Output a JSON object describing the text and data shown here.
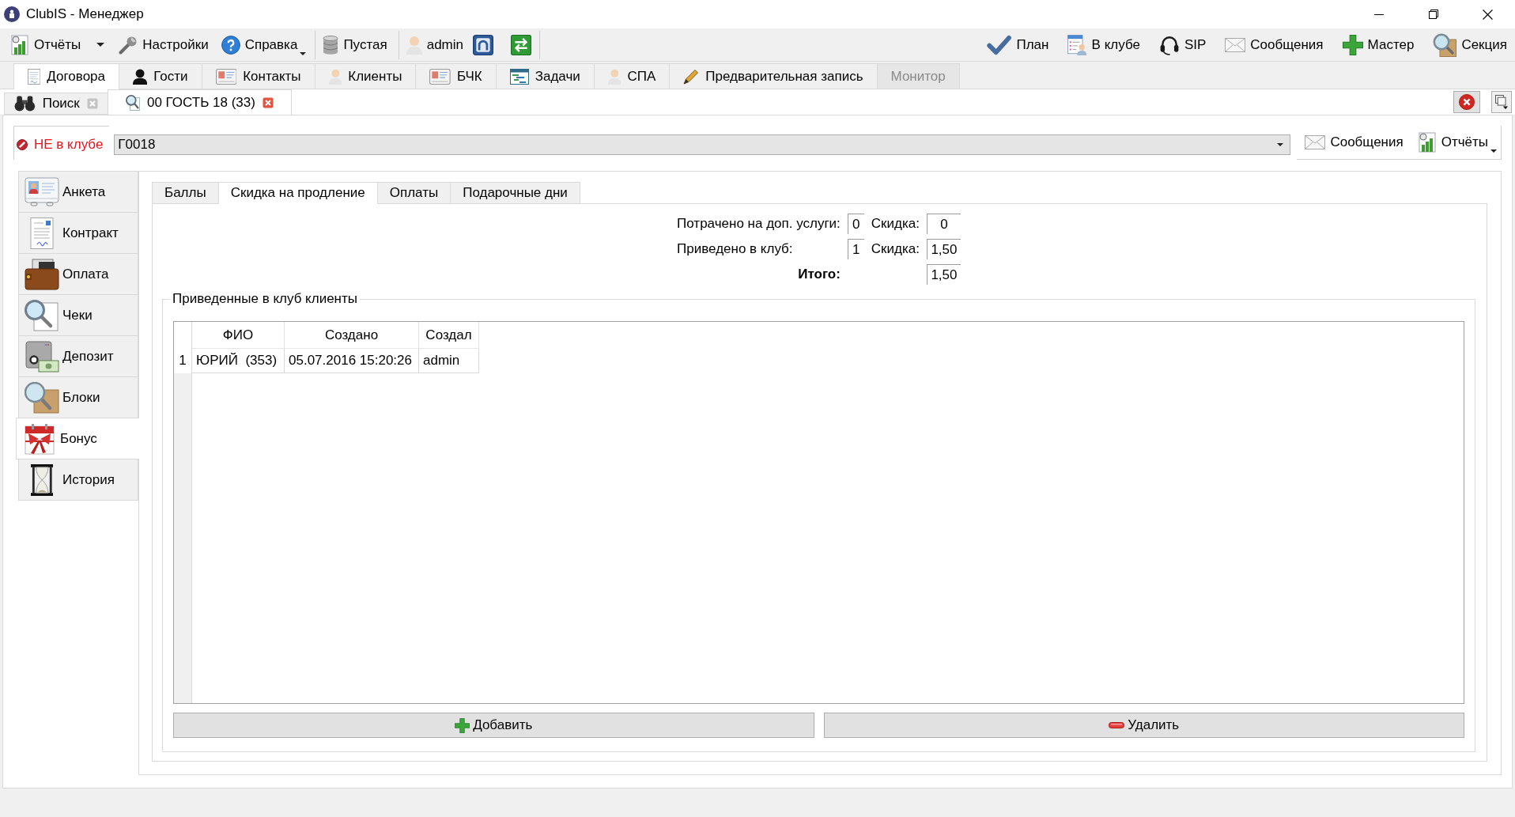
{
  "window": {
    "title": "ClubIS - Менеджер"
  },
  "toolbar": {
    "groups": [
      [
        {
          "label": "Отчёты",
          "kind": "split"
        },
        {
          "label": "Настройки",
          "kind": "plain"
        },
        {
          "label": "Справка",
          "kind": "menu"
        }
      ],
      [
        {
          "label": "Пустая",
          "kind": "plain"
        }
      ],
      [
        {
          "label": "admin",
          "kind": "plain"
        }
      ]
    ],
    "right": [
      {
        "label": "План"
      },
      {
        "label": "В клубе"
      },
      {
        "label": "SIP"
      },
      {
        "label": "Сообщения"
      },
      {
        "label": "Мастер"
      },
      {
        "label": "Секция"
      }
    ]
  },
  "main_tabs": [
    {
      "label": "Договора",
      "selected": true,
      "disabled": false
    },
    {
      "label": "Гости",
      "selected": false,
      "disabled": false
    },
    {
      "label": "Контакты",
      "selected": false,
      "disabled": false
    },
    {
      "label": "Клиенты",
      "selected": false,
      "disabled": false
    },
    {
      "label": "БЧК",
      "selected": false,
      "disabled": false
    },
    {
      "label": "Задачи",
      "selected": false,
      "disabled": false
    },
    {
      "label": "СПА",
      "selected": false,
      "disabled": false
    },
    {
      "label": "Предварительная запись",
      "selected": false,
      "disabled": false
    },
    {
      "label": "Монитор",
      "selected": false,
      "disabled": true
    }
  ],
  "document_tabs": [
    {
      "label": "Поиск",
      "selected": false
    },
    {
      "label": "00 ГОСТЬ 18 (33)",
      "selected": true
    }
  ],
  "client_bar": {
    "status": {
      "label": "НЕ в клубе",
      "in_club": false
    },
    "card": {
      "value": "Г0018"
    },
    "actions": [
      {
        "label": "Сообщения",
        "kind": "plain"
      },
      {
        "label": "Отчёты",
        "kind": "menu"
      }
    ]
  },
  "sidebar": {
    "items": [
      {
        "label": "Анкета",
        "selected": false
      },
      {
        "label": "Контракт",
        "selected": false
      },
      {
        "label": "Оплата",
        "selected": false
      },
      {
        "label": "Чеки",
        "selected": false
      },
      {
        "label": "Депозит",
        "selected": false
      },
      {
        "label": "Блоки",
        "selected": false
      },
      {
        "label": "Бонус",
        "selected": true
      },
      {
        "label": "История",
        "selected": false
      }
    ]
  },
  "bonus_tabs": [
    {
      "label": "Баллы",
      "selected": false
    },
    {
      "label": "Скидка на продление",
      "selected": true
    },
    {
      "label": "Оплаты",
      "selected": false
    },
    {
      "label": "Подарочные дни",
      "selected": false
    }
  ],
  "summary": {
    "rows": [
      {
        "label": "Потрачено на доп. услуги:",
        "count": "0",
        "discount_label": "Скидка:",
        "discount": "0"
      },
      {
        "label": "Приведено в клуб:",
        "count": "1",
        "discount_label": "Скидка:",
        "discount": "1,50"
      }
    ],
    "total": {
      "label": "Итого:",
      "value": "1,50"
    }
  },
  "clients_group": {
    "title": "Приведенные в клуб клиенты",
    "table": {
      "columns": [
        "ФИО",
        "Создано",
        "Создал"
      ],
      "rows": [
        {
          "number": "1",
          "cells": [
            "ЮРИЙ  (353)",
            "05.07.2016 15:20:26",
            "admin"
          ]
        }
      ]
    }
  },
  "buttons": [
    {
      "label": "Добавить"
    },
    {
      "label": "Удалить"
    }
  ]
}
